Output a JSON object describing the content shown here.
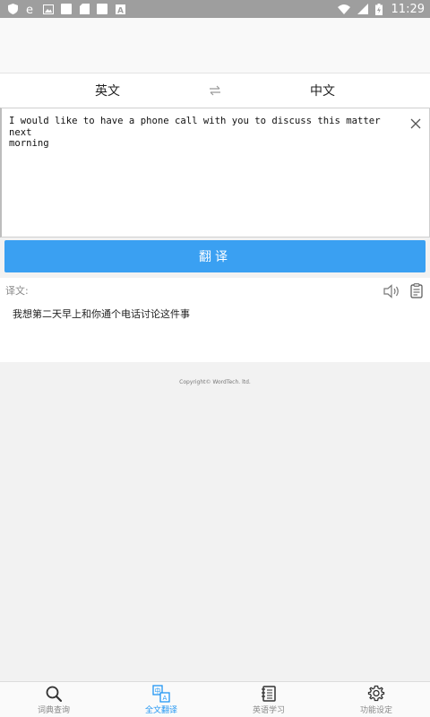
{
  "status_bar": {
    "time": "11:29",
    "icons": [
      "shield-icon",
      "ie-icon",
      "image-icon",
      "square-icon",
      "sd-card-icon",
      "square-icon",
      "a-icon"
    ],
    "right_icons": [
      "wifi-icon",
      "signal-icon",
      "battery-icon"
    ]
  },
  "language": {
    "source": "英文",
    "target": "中文",
    "swap_icon": "swap-arrows-icon"
  },
  "input": {
    "text": "I would like to have a phone call with you to discuss this matter next\nmorning"
  },
  "translate_button": "翻译",
  "result": {
    "label": "译文:",
    "text": "我想第二天早上和你通个电话讨论这件事"
  },
  "copyright": "Copyright© WordTech. ltd.",
  "tabs": [
    {
      "label": "词典查询",
      "icon": "search-icon",
      "active": false
    },
    {
      "label": "全文翻译",
      "icon": "translate-icon",
      "active": true
    },
    {
      "label": "英语学习",
      "icon": "notebook-icon",
      "active": false
    },
    {
      "label": "功能设定",
      "icon": "gear-icon",
      "active": false
    }
  ],
  "colors": {
    "accent": "#2196f3",
    "button": "#3aa0f2",
    "status_bar": "#9e9e9e"
  }
}
